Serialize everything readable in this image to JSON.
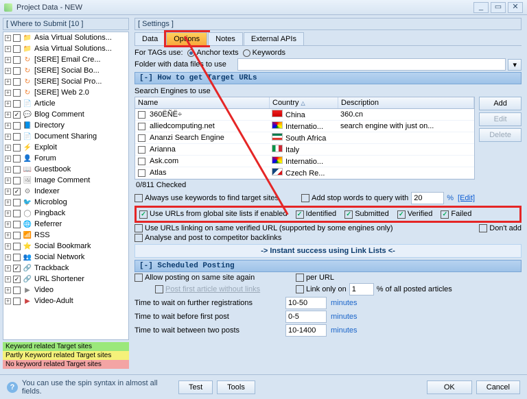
{
  "window": {
    "title": "Project Data - NEW"
  },
  "sidebar": {
    "header": "[ Where to Submit  [10 ]",
    "items": [
      {
        "label": "Asia Virtual Solutions...",
        "checked": false,
        "icon": "📁",
        "color": "#f0a030"
      },
      {
        "label": "Asia Virtual Solutions...",
        "checked": false,
        "icon": "📁",
        "color": "#f0a030"
      },
      {
        "label": "[SERE] Email Cre...",
        "checked": false,
        "icon": "↻",
        "color": "#f08030"
      },
      {
        "label": "[SERE] Social Bo...",
        "checked": false,
        "icon": "↻",
        "color": "#f08030"
      },
      {
        "label": "[SERE] Social Pro...",
        "checked": false,
        "icon": "↻",
        "color": "#f08030"
      },
      {
        "label": "[SERE] Web 2.0",
        "checked": false,
        "icon": "↻",
        "color": "#f08030"
      },
      {
        "label": "Article",
        "checked": false,
        "icon": "📄",
        "color": "#888"
      },
      {
        "label": "Blog Comment",
        "checked": true,
        "icon": "💬",
        "color": "#49a6e8"
      },
      {
        "label": "Directory",
        "checked": false,
        "icon": "📘",
        "color": "#49a6e8"
      },
      {
        "label": "Document Sharing",
        "checked": false,
        "icon": "📄",
        "color": "#888"
      },
      {
        "label": "Exploit",
        "checked": false,
        "icon": "⚡",
        "color": "#d0a000"
      },
      {
        "label": "Forum",
        "checked": false,
        "icon": "👤",
        "color": "#888"
      },
      {
        "label": "Guestbook",
        "checked": false,
        "icon": "📖",
        "color": "#888"
      },
      {
        "label": "Image Comment",
        "checked": false,
        "icon": "🖼",
        "color": "#888"
      },
      {
        "label": "Indexer",
        "checked": true,
        "icon": "⚙",
        "color": "#888"
      },
      {
        "label": "Microblog",
        "checked": false,
        "icon": "🐦",
        "color": "#33bdf2"
      },
      {
        "label": "Pingback",
        "checked": false,
        "icon": "◯",
        "color": "#888"
      },
      {
        "label": "Referrer",
        "checked": false,
        "icon": "🌐",
        "color": "#888"
      },
      {
        "label": "RSS",
        "checked": false,
        "icon": "📶",
        "color": "#f48c26"
      },
      {
        "label": "Social Bookmark",
        "checked": false,
        "icon": "⭐",
        "color": "#f4c726"
      },
      {
        "label": "Social Network",
        "checked": false,
        "icon": "👥",
        "color": "#f48c26"
      },
      {
        "label": "Trackback",
        "checked": true,
        "icon": "🔗",
        "color": "#888"
      },
      {
        "label": "URL Shortener",
        "checked": true,
        "icon": "🔗",
        "color": "#f48c26"
      },
      {
        "label": "Video",
        "checked": false,
        "icon": "▶",
        "color": "#888"
      },
      {
        "label": "Video-Adult",
        "checked": false,
        "icon": "▶",
        "color": "#c44"
      }
    ],
    "legend": {
      "green": "Keyword related Target sites",
      "yellow": "Partly Keyword related Target sites",
      "red": "No keyword related Target sites"
    }
  },
  "main": {
    "header": "[ Settings ]",
    "tabs": [
      "Data",
      "Options",
      "Notes",
      "External APIs"
    ],
    "activeTab": 1,
    "tags_label": "For TAGs use:",
    "tags_opts": [
      "Anchor texts",
      "Keywords"
    ],
    "folder_label": "Folder with data files to use",
    "section_targets": "[-]  How to get Target URLs",
    "se_label": "Search Engines to use",
    "grid": {
      "cols": [
        "Name",
        "Country",
        "Description"
      ],
      "rows": [
        {
          "name": "360ËÑË÷",
          "flag": "cn",
          "country": "China",
          "desc": "360.cn"
        },
        {
          "name": "alliedcomputing.net",
          "flag": "intl",
          "country": "Internatio...",
          "desc": "search engine with just on..."
        },
        {
          "name": "Ananzi Search Engine",
          "flag": "za",
          "country": "South Africa",
          "desc": ""
        },
        {
          "name": "Arianna",
          "flag": "it",
          "country": "Italy",
          "desc": ""
        },
        {
          "name": "Ask.com",
          "flag": "intl",
          "country": "Internatio...",
          "desc": ""
        },
        {
          "name": "Atlas",
          "flag": "cz",
          "country": "Czech Re...",
          "desc": ""
        }
      ],
      "checked_count": "0/811 Checked",
      "buttons": {
        "add": "Add",
        "edit": "Edit",
        "delete": "Delete"
      }
    },
    "opts": {
      "always_kw": "Always use keywords to find target sites",
      "stop_words": "Add stop words to query with",
      "stop_n": "20",
      "pct": "%",
      "edit": "[Edit]",
      "global": "Use URLs from global site lists if enabled",
      "identified": "Identified",
      "submitted": "Submitted",
      "verified": "Verified",
      "failed": "Failed",
      "same_url": "Use URLs linking on same verified URL (supported by some engines only)",
      "dont_add": "Don't add",
      "analyse": "Analyse and post to competitor backlinks",
      "instant": "->  Instant success using Link Lists  <-"
    },
    "section_sched": "[-]  Scheduled Posting",
    "sched": {
      "allow": "Allow posting on same site again",
      "per_url": "per URL",
      "post_first": "Post first article without links",
      "link_only": "Link only on",
      "link_n": "1",
      "link_txt": "% of all posted articles",
      "wait_reg": "Time to wait on further registrations",
      "wait_reg_v": "10-50",
      "wait_first": "Time to wait before first post",
      "wait_first_v": "0-5",
      "wait_two": "Time to wait between two posts",
      "wait_two_v": "10-1400",
      "min": "minutes"
    }
  },
  "footer": {
    "hint": "You can use the spin syntax in almost all fields.",
    "test": "Test",
    "tools": "Tools",
    "ok": "OK",
    "cancel": "Cancel"
  }
}
